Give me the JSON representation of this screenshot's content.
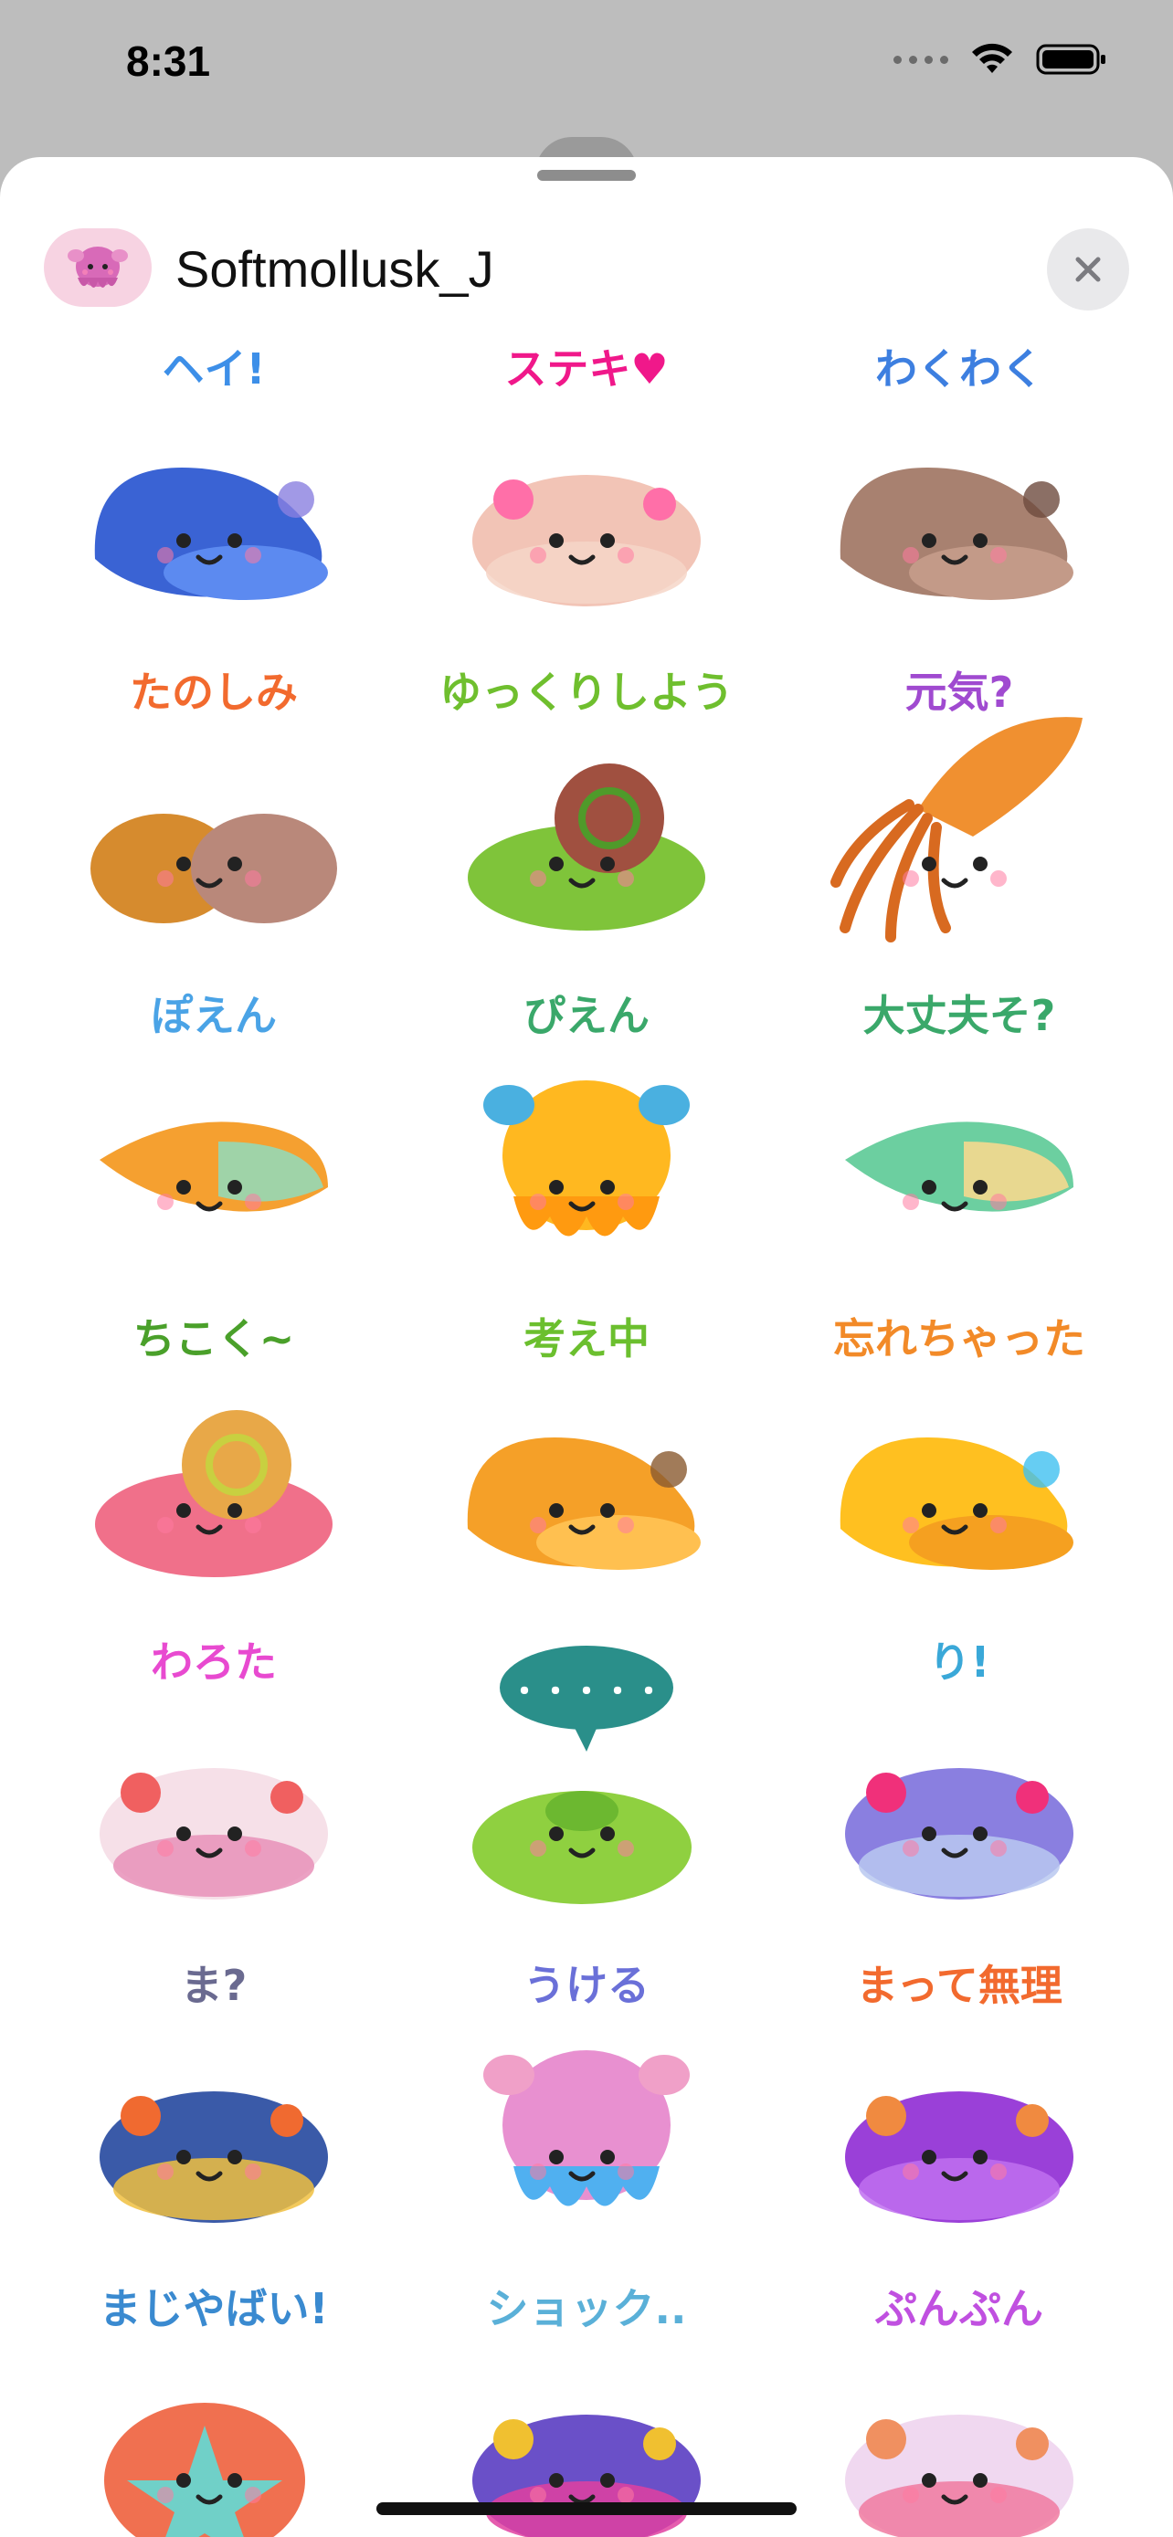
{
  "status_bar": {
    "time": "8:31"
  },
  "header": {
    "title": "Softmollusk_J",
    "avatar_icon": "dumbo-octopus-icon",
    "close_icon": "close-icon"
  },
  "stickers": [
    {
      "caption": "ヘイ!",
      "caption_color": "#3d8fe8",
      "body": "#3a63d4",
      "belly": "#5c8af0",
      "shape": "slug",
      "accent": "#8a7fe0"
    },
    {
      "caption": "ステキ♥",
      "caption_color": "#f0188a",
      "body": "#f2c4b6",
      "belly": "#f6d6c8",
      "shape": "blob",
      "accent": "#ff6fa8"
    },
    {
      "caption": "わくわく",
      "caption_color": "#3d7fe0",
      "body": "#a88170",
      "belly": "#c39a88",
      "shape": "slug",
      "accent": "#6e4b3e"
    },
    {
      "caption": "たのしみ",
      "caption_color": "#f26a2e",
      "body": "#d68b2e",
      "belly": "#b9887a",
      "shape": "pair",
      "accent": "#7a4a2a"
    },
    {
      "caption": "ゆっくりしよう",
      "caption_color": "#6fbf2e",
      "body": "#7fc43a",
      "belly": "#a05040",
      "shape": "snail",
      "accent": "#4f9a2a"
    },
    {
      "caption": "元気?",
      "caption_color": "#a04ad0",
      "body": "#f09030",
      "belly": "#d86a20",
      "shape": "squid",
      "accent": "#c05a18"
    },
    {
      "caption": "ぽえん",
      "caption_color": "#4aa3e6",
      "body": "#f5a030",
      "belly": "#9fd3a8",
      "shape": "cuttle",
      "accent": "#e07a20"
    },
    {
      "caption": "ぴえん",
      "caption_color": "#3aa86a",
      "body": "#ffb820",
      "belly": "#ff9a10",
      "shape": "octo",
      "accent": "#4ab0e0"
    },
    {
      "caption": "大丈夫そ?",
      "caption_color": "#3aa86a",
      "body": "#6ccfa0",
      "belly": "#e8d890",
      "shape": "cuttle",
      "accent": "#f0c040"
    },
    {
      "caption": "ちこく~",
      "caption_color": "#4aa02a",
      "body": "#f0708a",
      "belly": "#e8a848",
      "shape": "snail",
      "accent": "#c8d040"
    },
    {
      "caption": "考え中",
      "caption_color": "#6bbf2e",
      "body": "#f5a028",
      "belly": "#ffc050",
      "shape": "slug",
      "accent": "#8a5a30"
    },
    {
      "caption": "忘れちゃった",
      "caption_color": "#f28a28",
      "body": "#ffc020",
      "belly": "#f5a020",
      "shape": "slug",
      "accent": "#40c0f0"
    },
    {
      "caption": "わろた",
      "caption_color": "#e84ad0",
      "body": "#f6e0e8",
      "belly": "#e890b8",
      "shape": "blob",
      "accent": "#f06060"
    },
    {
      "caption": "・・・・・",
      "caption_color": "#ffffff",
      "body": "#8fd040",
      "belly": "#6cb830",
      "shape": "bubble",
      "accent": "#2a8f8a"
    },
    {
      "caption": "り!",
      "caption_color": "#3aa8d8",
      "body": "#8a7fe0",
      "belly": "#b8c8f0",
      "shape": "blob",
      "accent": "#f0307a"
    },
    {
      "caption": "ま?",
      "caption_color": "#6a6a90",
      "body": "#3a5aa8",
      "belly": "#f0c040",
      "shape": "blob",
      "accent": "#f06a30"
    },
    {
      "caption": "うける",
      "caption_color": "#6a70d8",
      "body": "#e890d0",
      "belly": "#50b0f0",
      "shape": "octo",
      "accent": "#f0a0c8"
    },
    {
      "caption": "まって無理",
      "caption_color": "#f26a2e",
      "body": "#9a40d8",
      "belly": "#c070f0",
      "shape": "blob",
      "accent": "#f08a40"
    },
    {
      "caption": "まじやばい!",
      "caption_color": "#3a8ad0",
      "body": "#70d0c8",
      "belly": "#f07050",
      "shape": "star",
      "accent": "#f0d040"
    },
    {
      "caption": "ショック..",
      "caption_color": "#5ab0d8",
      "body": "#6a50c8",
      "belly": "#e040a0",
      "shape": "blob",
      "accent": "#f0c030"
    },
    {
      "caption": "ぷんぷん",
      "caption_color": "#c050e0",
      "body": "#f0d8f0",
      "belly": "#f07aa0",
      "shape": "blob",
      "accent": "#f09060"
    }
  ]
}
